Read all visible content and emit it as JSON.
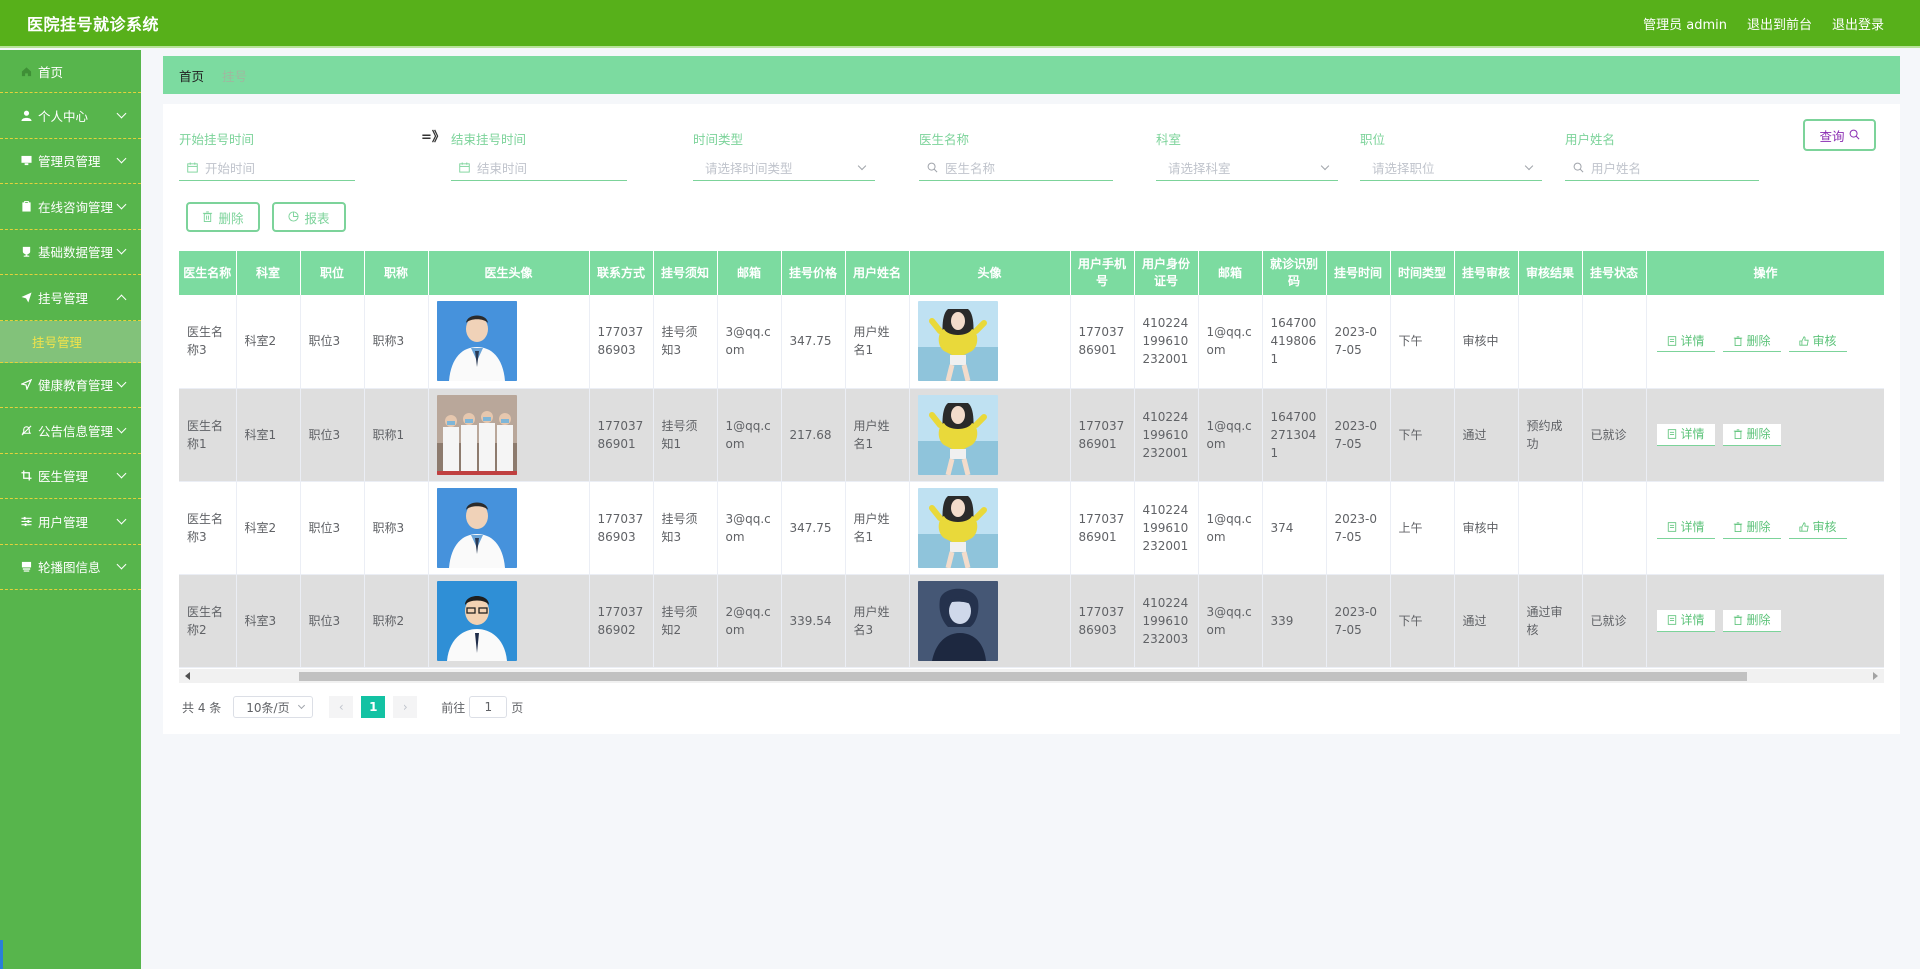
{
  "app": {
    "title": "医院挂号就诊系统",
    "admin_label": "管理员 admin",
    "front_link": "退出到前台",
    "logout_link": "退出登录"
  },
  "sidebar": {
    "items": [
      {
        "label": "首页",
        "icon": "home-icon"
      },
      {
        "label": "个人中心",
        "icon": "user-icon"
      },
      {
        "label": "管理员管理",
        "icon": "monitor-icon"
      },
      {
        "label": "在线咨询管理",
        "icon": "clipboard-icon"
      },
      {
        "label": "基础数据管理",
        "icon": "cup-icon"
      },
      {
        "label": "挂号管理",
        "icon": "send-icon",
        "expanded": true,
        "children": [
          "挂号管理"
        ]
      },
      {
        "label": "健康教育管理",
        "icon": "navigation-icon"
      },
      {
        "label": "公告信息管理",
        "icon": "muted-bell-icon"
      },
      {
        "label": "医生管理",
        "icon": "crop-icon"
      },
      {
        "label": "用户管理",
        "icon": "sliders-icon"
      },
      {
        "label": "轮播图信息",
        "icon": "stack-icon"
      }
    ]
  },
  "breadcrumb": {
    "home": "首页",
    "current": "挂号"
  },
  "filters": {
    "start_label": "开始挂号时间",
    "start_placeholder": "开始时间",
    "end_label": "结束挂号时间",
    "end_placeholder": "结束时间",
    "swap_symbol": "=》",
    "time_type_label": "时间类型",
    "time_type_placeholder": "请选择时间类型",
    "doctor_label": "医生名称",
    "doctor_placeholder": "医生名称",
    "dept_label": "科室",
    "dept_placeholder": "请选择科室",
    "position_label": "职位",
    "position_placeholder": "请选择职位",
    "user_label": "用户姓名",
    "user_placeholder": "用户姓名",
    "query_button": "查询"
  },
  "actions": {
    "delete": "删除",
    "report": "报表"
  },
  "table": {
    "headers": [
      "医生名称",
      "科室",
      "职位",
      "职称",
      "医生头像",
      "联系方式",
      "挂号须知",
      "邮箱",
      "挂号价格",
      "用户姓名",
      "头像",
      "用户手机号",
      "用户身份证号",
      "邮箱",
      "就诊识别码",
      "挂号时间",
      "时间类型",
      "挂号审核",
      "审核结果",
      "挂号状态",
      "操作"
    ],
    "rows": [
      {
        "doctor": "医生名称3",
        "dept": "科室2",
        "position": "职位3",
        "title": "职称3",
        "doctor_avatar": "doctor-portrait-male-1",
        "phone": "17703786903",
        "notice": "挂号须知3",
        "email": "3@qq.com",
        "price": "347.75",
        "user": "用户姓名1",
        "user_avatar": "user-yellow-sweater",
        "user_phone": "17703786901",
        "id_no": "410224199610232001",
        "user_email": "1@qq.com",
        "code": "1647004198061",
        "time": "2023-07-05",
        "time_type": "下午",
        "review": "审核中",
        "result": "",
        "status": "",
        "ops": [
          "详情",
          "删除",
          "审核"
        ]
      },
      {
        "doctor": "医生名称1",
        "dept": "科室1",
        "position": "职位3",
        "title": "职称1",
        "doctor_avatar": "doctor-group-photo",
        "phone": "17703786901",
        "notice": "挂号须知1",
        "email": "1@qq.com",
        "price": "217.68",
        "user": "用户姓名1",
        "user_avatar": "user-yellow-sweater",
        "user_phone": "17703786901",
        "id_no": "410224199610232001",
        "user_email": "1@qq.com",
        "code": "1647002713041",
        "time": "2023-07-05",
        "time_type": "下午",
        "review": "通过",
        "result": "预约成功",
        "status": "已就诊",
        "ops": [
          "详情",
          "删除"
        ]
      },
      {
        "doctor": "医生名称3",
        "dept": "科室2",
        "position": "职位3",
        "title": "职称3",
        "doctor_avatar": "doctor-portrait-male-1",
        "phone": "17703786903",
        "notice": "挂号须知3",
        "email": "3@qq.com",
        "price": "347.75",
        "user": "用户姓名1",
        "user_avatar": "user-yellow-sweater",
        "user_phone": "17703786901",
        "id_no": "410224199610232001",
        "user_email": "1@qq.com",
        "code": "374",
        "time": "2023-07-05",
        "time_type": "上午",
        "review": "审核中",
        "result": "",
        "status": "",
        "ops": [
          "详情",
          "删除",
          "审核"
        ]
      },
      {
        "doctor": "医生名称2",
        "dept": "科室3",
        "position": "职位3",
        "title": "职称2",
        "doctor_avatar": "doctor-portrait-glasses",
        "phone": "17703786902",
        "notice": "挂号须知2",
        "email": "2@qq.com",
        "price": "339.54",
        "user": "用户姓名3",
        "user_avatar": "user-dark-anime",
        "user_phone": "17703786903",
        "id_no": "410224199610232003",
        "user_email": "3@qq.com",
        "code": "339",
        "time": "2023-07-05",
        "time_type": "下午",
        "review": "通过",
        "result": "通过审核",
        "status": "已就诊",
        "ops": [
          "详情",
          "删除"
        ]
      }
    ]
  },
  "pagination": {
    "total": "共 4 条",
    "page_size": "10条/页",
    "current_page": "1",
    "goto_prefix": "前往",
    "goto_value": "1",
    "goto_suffix": "页"
  },
  "colors": {
    "topbar": "#57b01a",
    "sidebar": "#57b54c",
    "accent": "#7cdba0",
    "active_page": "#13c2a3",
    "submenu_text": "#f2e34a"
  }
}
